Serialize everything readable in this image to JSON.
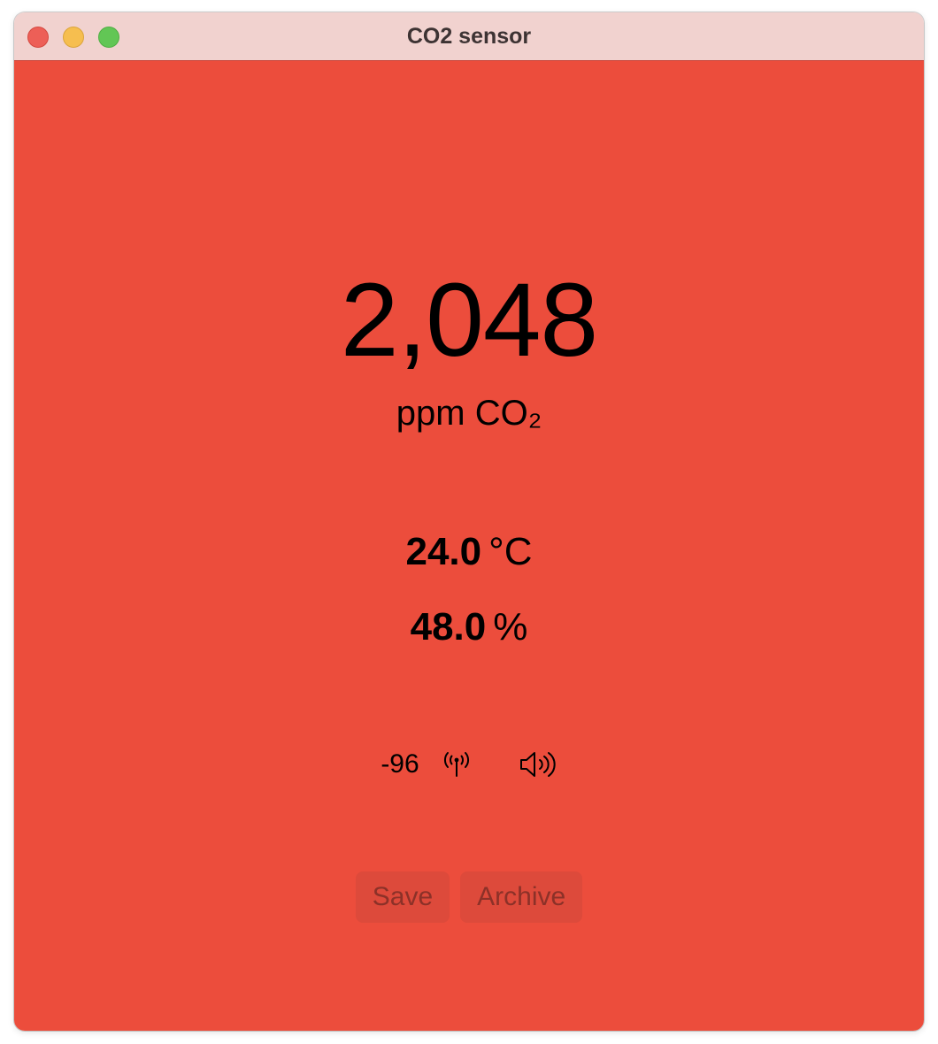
{
  "window": {
    "title": "CO2 sensor"
  },
  "co2": {
    "value": "2,048",
    "unit": "ppm CO₂"
  },
  "temperature": {
    "value": "24.0",
    "unit": "°C"
  },
  "humidity": {
    "value": "48.0",
    "unit": "%"
  },
  "status": {
    "rssi": "-96",
    "signal_icon": "antenna-icon",
    "sound_icon": "speaker-icon"
  },
  "buttons": {
    "save_label": "Save",
    "archive_label": "Archive"
  },
  "colors": {
    "background": "#ec4d3c",
    "titlebar": "#f1d2cf"
  }
}
